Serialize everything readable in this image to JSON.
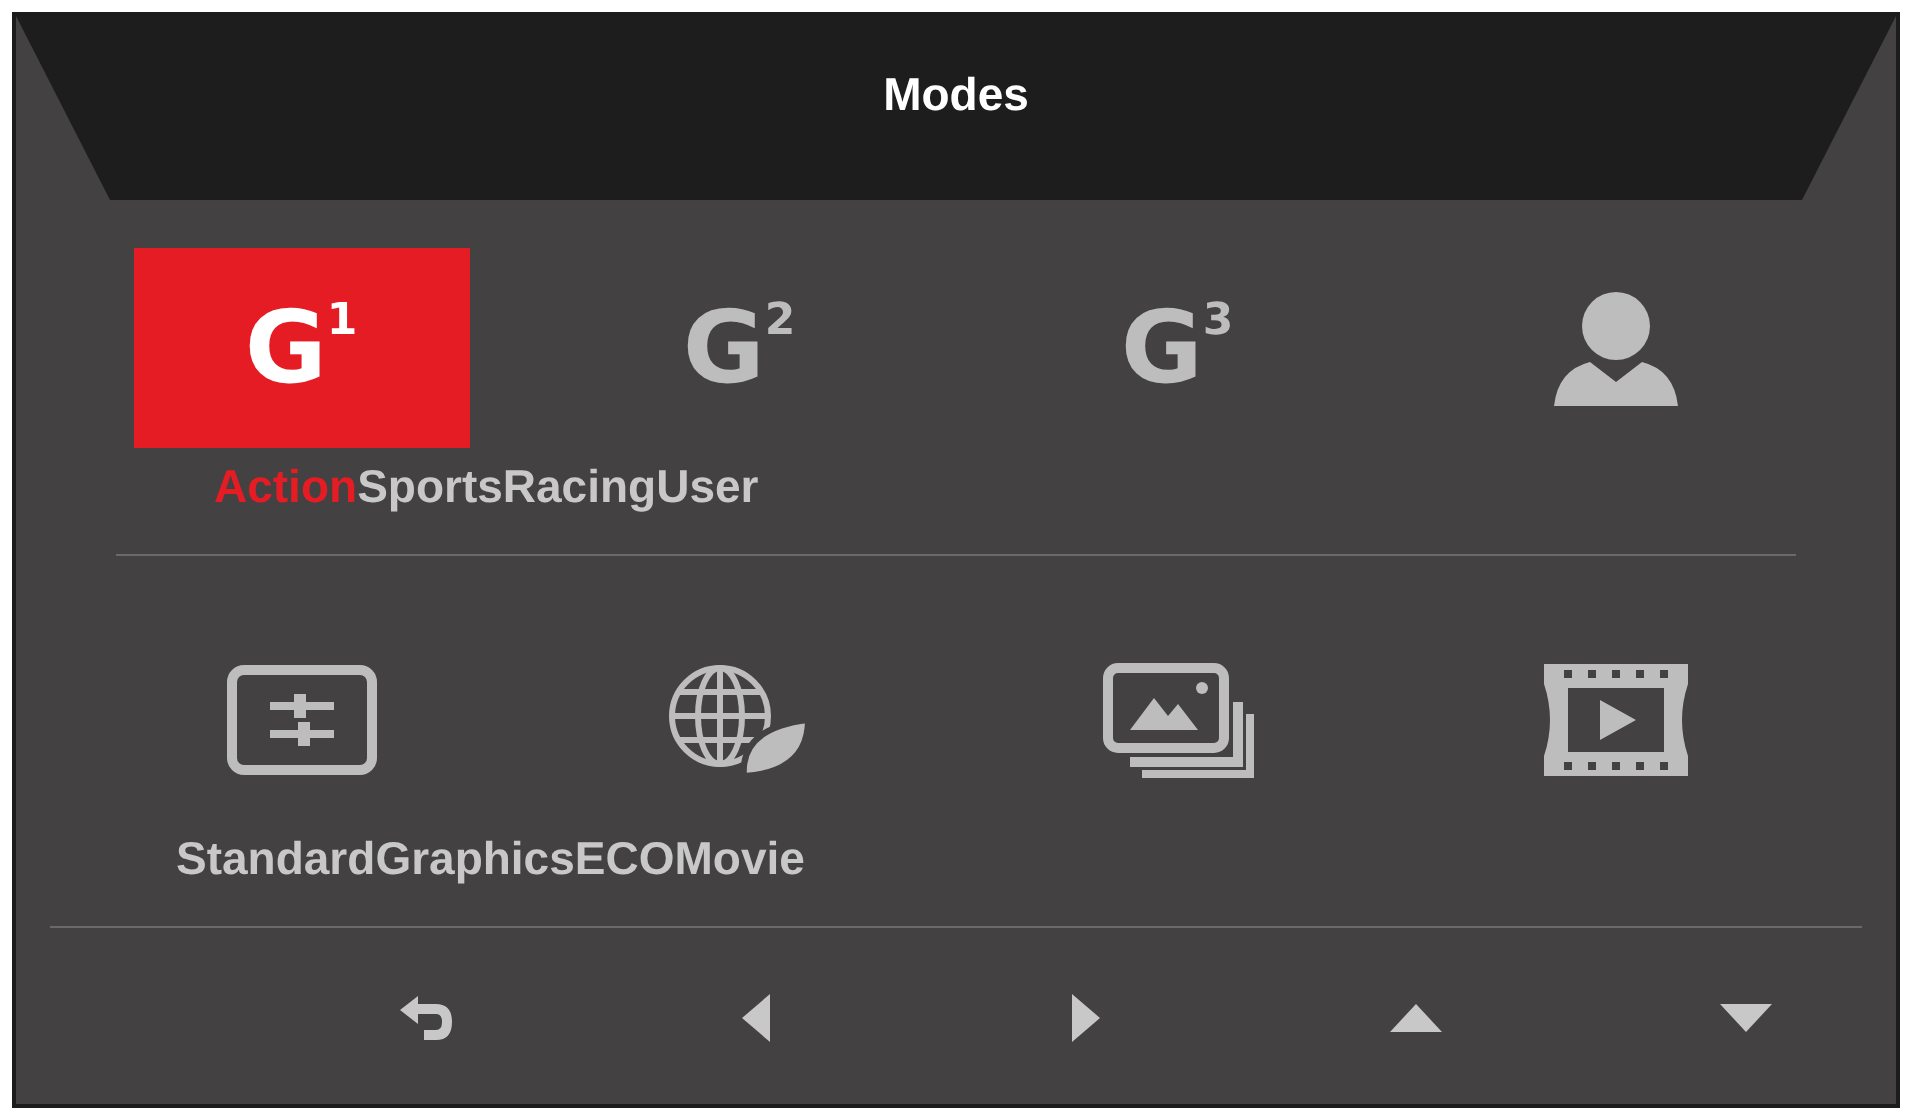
{
  "title": "Modes",
  "mode_rows": [
    {
      "items": [
        {
          "icon_text": "G$^{1}$",
          "kind": "glyph",
          "label": "Action",
          "selected": true
        },
        {
          "icon_text": "G$^{2}$",
          "kind": "glyph",
          "label": "Sports",
          "selected": false
        },
        {
          "icon_text": "G$^{3}$",
          "kind": "glyph",
          "label": "Racing",
          "selected": false
        },
        {
          "kind": "user",
          "label": "User",
          "selected": false
        }
      ]
    },
    {
      "items": [
        {
          "kind": "sliders",
          "label": "Standard",
          "selected": false
        },
        {
          "kind": "globe-leaf",
          "label": "Graphics",
          "selected": false
        },
        {
          "kind": "pictures",
          "label": "ECO",
          "selected": false
        },
        {
          "kind": "film",
          "label": "Movie",
          "selected": false
        }
      ]
    }
  ],
  "nav_keys": [
    {
      "kind": "back"
    },
    {
      "kind": "left"
    },
    {
      "kind": "right"
    },
    {
      "kind": "up"
    },
    {
      "kind": "down"
    }
  ]
}
